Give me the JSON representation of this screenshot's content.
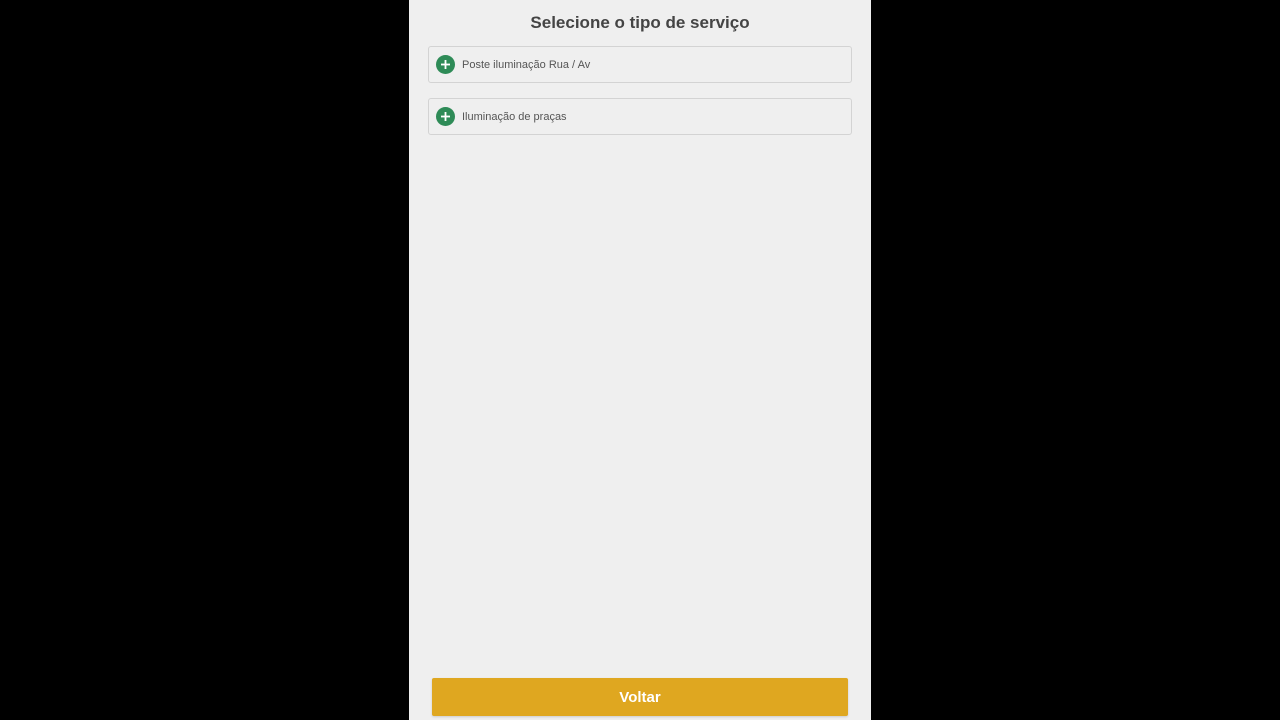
{
  "page": {
    "title": "Selecione o tipo de serviço"
  },
  "services": [
    {
      "label": "Poste iluminação Rua / Av",
      "icon": "plus-circle-icon"
    },
    {
      "label": "Iluminação de praças",
      "icon": "plus-circle-icon"
    }
  ],
  "footer": {
    "back_label": "Voltar"
  },
  "colors": {
    "background_outer": "#000000",
    "screen_background": "#efefef",
    "accent_green": "#2e8b57",
    "button_yellow": "#dfa720",
    "title_text": "#444444",
    "item_text": "#555555"
  }
}
